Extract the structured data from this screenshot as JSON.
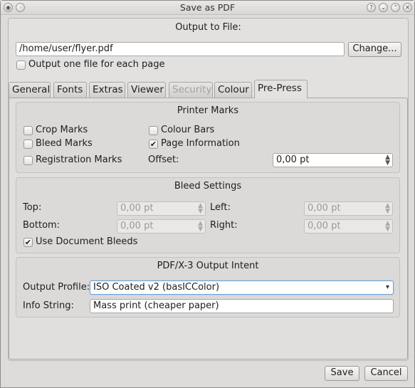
{
  "window": {
    "title": "Save as PDF"
  },
  "output": {
    "heading": "Output to File:",
    "file_path": "/home/user/flyer.pdf",
    "change_button": "Change...",
    "one_file_per_page_label": "Output one file for each page",
    "one_file_per_page_checked": false
  },
  "tabs": [
    {
      "label": "General"
    },
    {
      "label": "Fonts"
    },
    {
      "label": "Extras"
    },
    {
      "label": "Viewer"
    },
    {
      "label": "Security",
      "disabled": true
    },
    {
      "label": "Colour"
    },
    {
      "label": "Pre-Press",
      "active": true
    }
  ],
  "printer_marks": {
    "title": "Printer Marks",
    "crop_marks": {
      "label": "Crop Marks",
      "checked": false
    },
    "bleed_marks": {
      "label": "Bleed Marks",
      "checked": false
    },
    "registration_marks": {
      "label": "Registration Marks",
      "checked": false
    },
    "colour_bars": {
      "label": "Colour Bars",
      "checked": false
    },
    "page_information": {
      "label": "Page Information",
      "checked": true
    },
    "offset_label": "Offset:",
    "offset_value": "0,00 pt"
  },
  "bleed": {
    "title": "Bleed Settings",
    "top_label": "Top:",
    "top_value": "0,00 pt",
    "bottom_label": "Bottom:",
    "bottom_value": "0,00 pt",
    "left_label": "Left:",
    "left_value": "0,00 pt",
    "right_label": "Right:",
    "right_value": "0,00 pt",
    "use_document_bleeds": {
      "label": "Use Document Bleeds",
      "checked": true
    }
  },
  "intent": {
    "title": "PDF/X-3 Output Intent",
    "profile_label": "Output Profile:",
    "profile_value": "ISO Coated v2 (basICColor)",
    "info_label": "Info String:",
    "info_value": "Mass print (cheaper paper)"
  },
  "buttons": {
    "save": "Save",
    "cancel": "Cancel"
  },
  "icons": {
    "check": "✔",
    "spin": "⌃⌄",
    "dropdown": "⌄"
  }
}
